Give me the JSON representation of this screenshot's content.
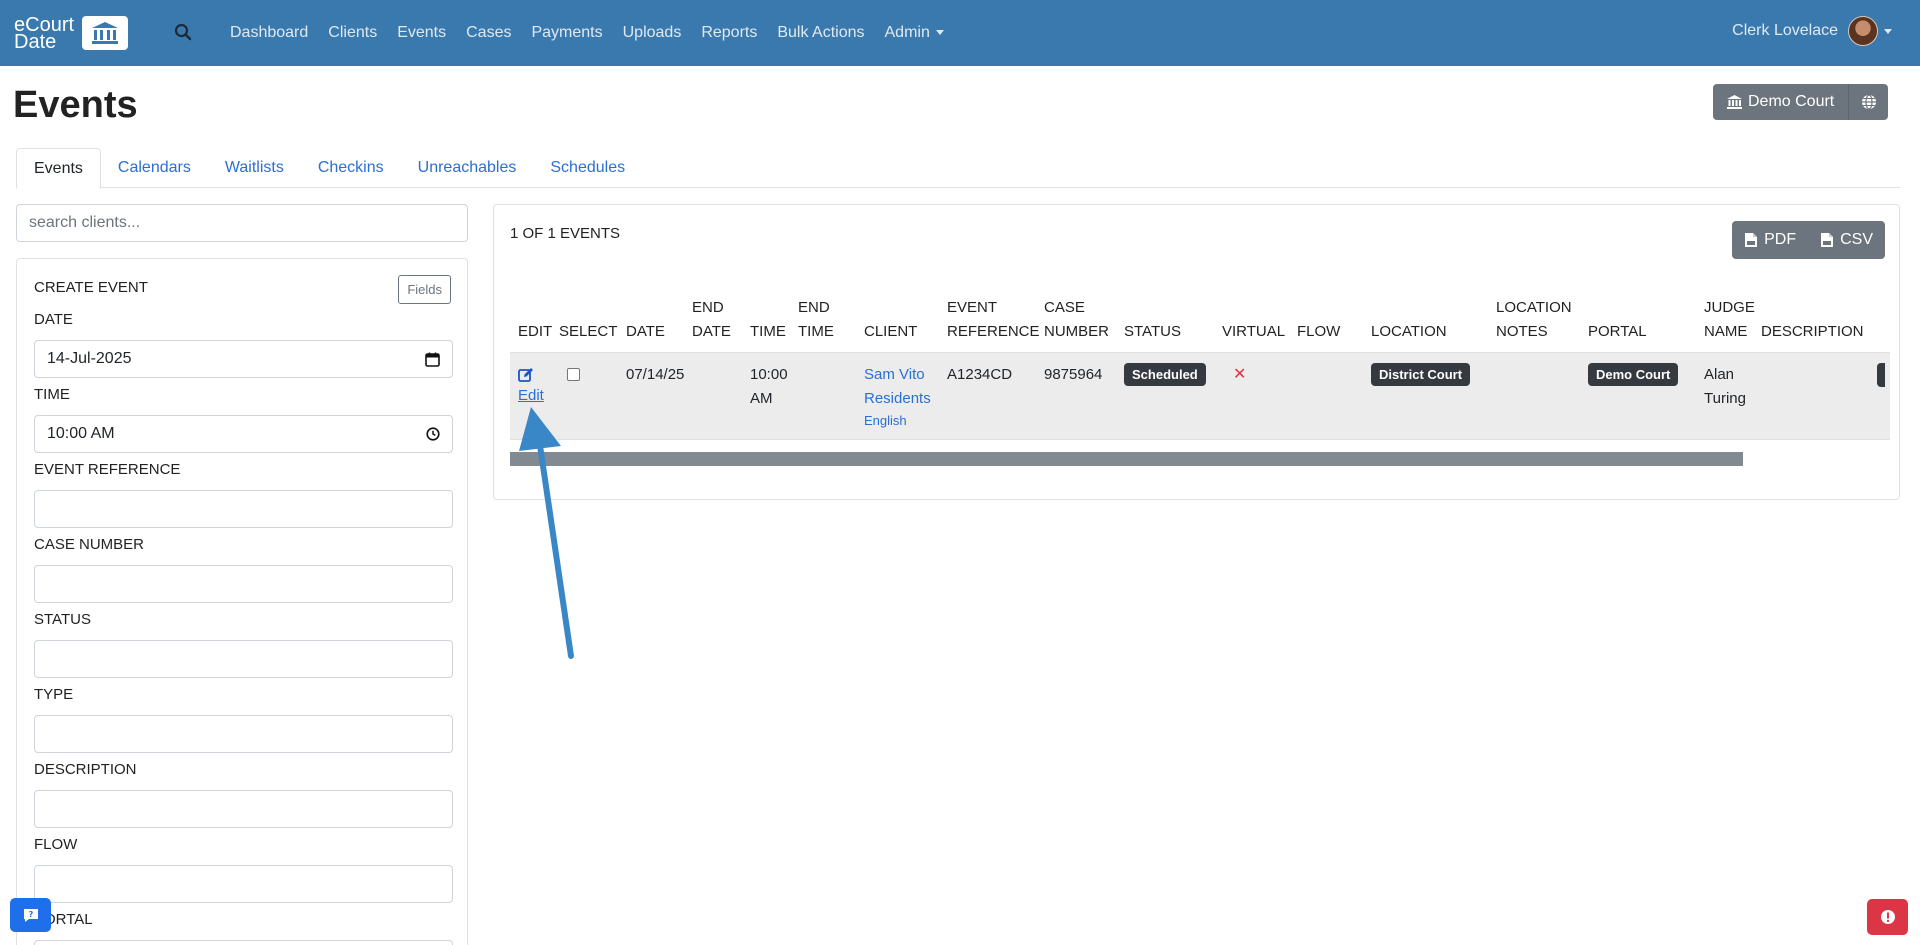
{
  "brand": {
    "line1": "eCourt",
    "line2": "Date",
    "logo_icon": "courthouse-icon"
  },
  "nav": {
    "links": [
      "Dashboard",
      "Clients",
      "Events",
      "Cases",
      "Payments",
      "Uploads",
      "Reports",
      "Bulk Actions",
      "Admin"
    ],
    "user_name": "Clerk Lovelace"
  },
  "page": {
    "title": "Events",
    "court_button": "Demo Court"
  },
  "tabs": [
    "Events",
    "Calendars",
    "Waitlists",
    "Checkins",
    "Unreachables",
    "Schedules"
  ],
  "search": {
    "placeholder": "search clients..."
  },
  "create": {
    "title": "CREATE EVENT",
    "fields_button": "Fields",
    "labels": {
      "date": "DATE",
      "time": "TIME",
      "event_reference": "EVENT REFERENCE",
      "case_number": "CASE NUMBER",
      "status": "STATUS",
      "type": "TYPE",
      "description": "DESCRIPTION",
      "flow": "FLOW",
      "portal": "PORTAL"
    },
    "values": {
      "date": "14-Jul-2025",
      "time": "10:00 AM"
    }
  },
  "events": {
    "count": "1 OF 1 EVENTS",
    "export": {
      "pdf": "PDF",
      "csv": "CSV"
    },
    "columns": {
      "edit": "EDIT",
      "select": "SELECT",
      "date": "DATE",
      "end_date_1": "END",
      "end_date_2": "DATE",
      "time": "TIME",
      "end_time_1": "END",
      "end_time_2": "TIME",
      "client": "CLIENT",
      "event_ref_1": "EVENT",
      "event_ref_2": "REFERENCE",
      "case_num_1": "CASE",
      "case_num_2": "NUMBER",
      "status": "STATUS",
      "virtual": "VIRTUAL",
      "flow": "FLOW",
      "location": "LOCATION",
      "loc_notes_1": "LOCATION",
      "loc_notes_2": "NOTES",
      "portal": "PORTAL",
      "judge_1": "JUDGE",
      "judge_2": "NAME",
      "description": "DESCRIPTION"
    },
    "row": {
      "edit_label": "Edit",
      "date": "07/14/25",
      "time_1": "10:00",
      "time_2": "AM",
      "client_1": "Sam Vito",
      "client_2": "Residents",
      "language": "English",
      "event_reference": "A1234CD",
      "case_number": "9875964",
      "status": "Scheduled",
      "virtual": "✕",
      "location": "District Court",
      "portal": "Demo Court",
      "judge_1": "Alan",
      "judge_2": "Turing"
    }
  },
  "colors": {
    "navbar": "#3a79ad",
    "link": "#2a6fd6",
    "badge": "#343a40",
    "secondary": "#6c757d",
    "arrow": "#3a87c8",
    "danger": "#dc3545",
    "chat": "#1f6feb"
  }
}
